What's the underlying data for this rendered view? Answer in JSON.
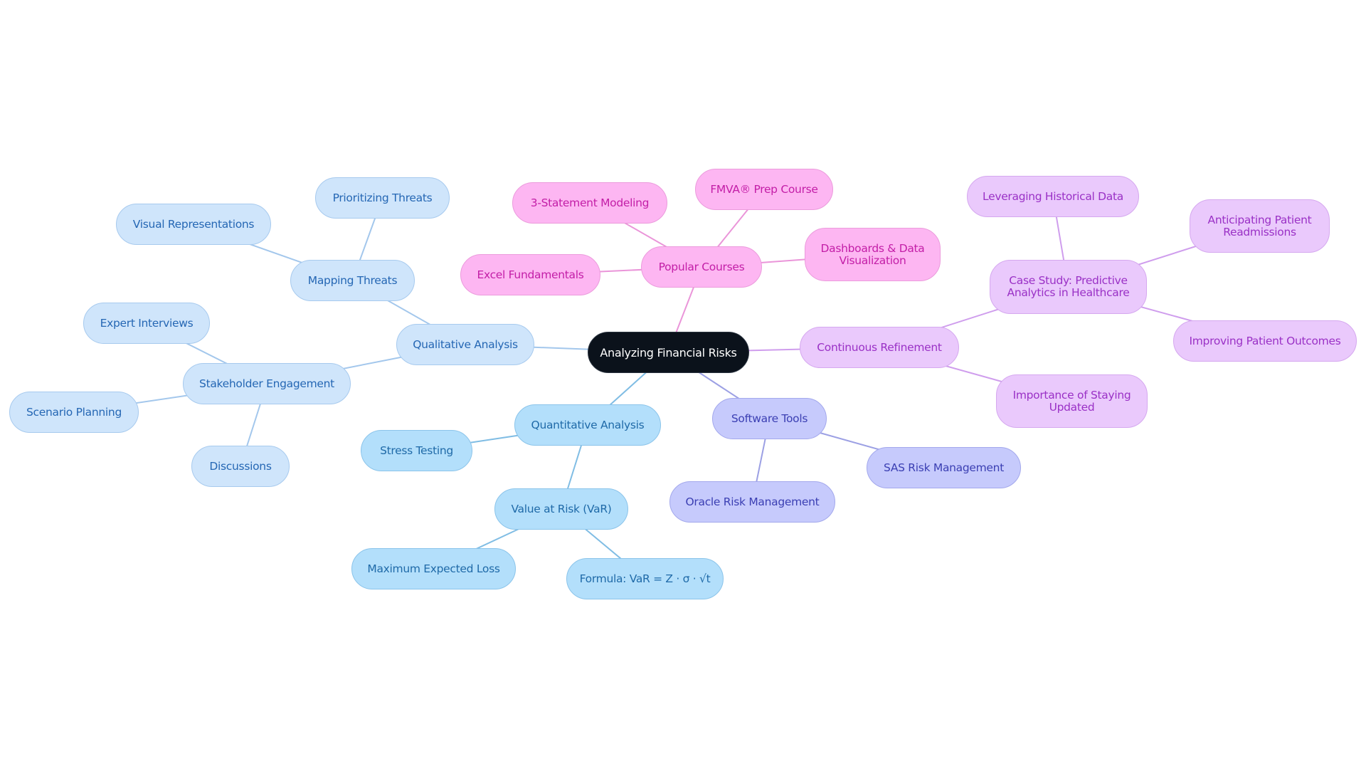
{
  "title": "Analyzing Financial Risks",
  "colors": {
    "qualitative": "#a3c7ec",
    "quantitative": "#80bde4",
    "courses": "#ea95d9",
    "refinement": "#cf9ded",
    "tools": "#9ca0e4"
  },
  "root": {
    "id": "root",
    "label": "Analyzing Financial Risks"
  },
  "branches": [
    {
      "id": "qualitative-analysis",
      "label": "Qualitative Analysis",
      "theme": "qual",
      "children": [
        {
          "id": "mapping-threats",
          "label": "Mapping Threats",
          "children": [
            {
              "id": "prioritizing-threats",
              "label": "Prioritizing Threats"
            },
            {
              "id": "visual-representations",
              "label": "Visual Representations"
            }
          ]
        },
        {
          "id": "stakeholder-engagement",
          "label": "Stakeholder Engagement",
          "children": [
            {
              "id": "expert-interviews",
              "label": "Expert Interviews"
            },
            {
              "id": "scenario-planning",
              "label": "Scenario Planning"
            },
            {
              "id": "discussions",
              "label": "Discussions"
            }
          ]
        }
      ]
    },
    {
      "id": "quantitative-analysis",
      "label": "Quantitative Analysis",
      "theme": "quant",
      "children": [
        {
          "id": "stress-testing",
          "label": "Stress Testing"
        },
        {
          "id": "value-at-risk",
          "label": "Value at Risk (VaR)",
          "children": [
            {
              "id": "maximum-expected-loss",
              "label": "Maximum Expected Loss"
            },
            {
              "id": "var-formula",
              "label": "Formula: VaR = Z · σ · √t"
            }
          ]
        }
      ]
    },
    {
      "id": "popular-courses",
      "label": "Popular Courses",
      "theme": "course",
      "children": [
        {
          "id": "excel-fundamentals",
          "label": "Excel Fundamentals"
        },
        {
          "id": "three-statement-modeling",
          "label": "3-Statement Modeling"
        },
        {
          "id": "fmva-prep-course",
          "label": "FMVA® Prep Course"
        },
        {
          "id": "dashboards-data-visualization",
          "label": "Dashboards & Data\nVisualization"
        }
      ]
    },
    {
      "id": "continuous-refinement",
      "label": "Continuous Refinement",
      "theme": "refine",
      "children": [
        {
          "id": "case-study",
          "label": "Case Study: Predictive\nAnalytics in Healthcare",
          "children": [
            {
              "id": "leveraging-historical-data",
              "label": "Leveraging Historical Data"
            },
            {
              "id": "anticipating-patient-readmissions",
              "label": "Anticipating Patient\nReadmissions"
            },
            {
              "id": "improving-patient-outcomes",
              "label": "Improving Patient Outcomes"
            }
          ]
        },
        {
          "id": "importance-of-staying-updated",
          "label": "Importance of Staying\nUpdated"
        }
      ]
    },
    {
      "id": "software-tools",
      "label": "Software Tools",
      "theme": "tools",
      "children": [
        {
          "id": "sas-risk-management",
          "label": "SAS Risk Management"
        },
        {
          "id": "oracle-risk-management",
          "label": "Oracle Risk Management"
        }
      ]
    }
  ]
}
